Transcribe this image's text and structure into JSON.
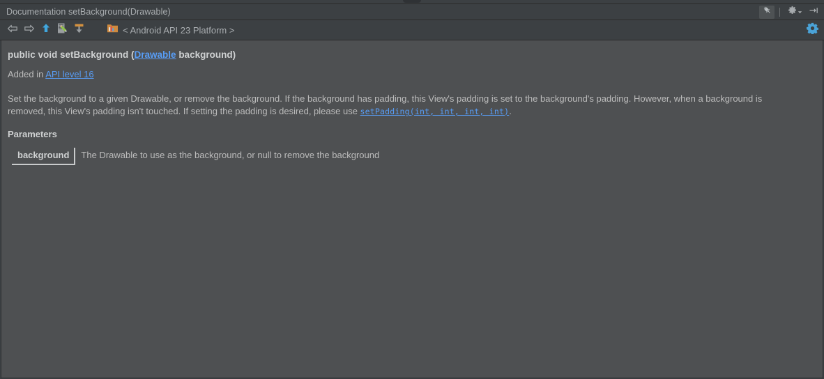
{
  "titlebar": {
    "title": "Documentation setBackground(Drawable)",
    "actions": [
      {
        "name": "pin-icon",
        "label": "Pin",
        "selected": true
      },
      {
        "name": "gear-icon",
        "label": "Settings",
        "selected": false
      },
      {
        "name": "hide-icon",
        "label": "Hide",
        "selected": false
      }
    ]
  },
  "toolbar": {
    "buttons": [
      {
        "name": "back-icon",
        "label": "Back"
      },
      {
        "name": "forward-icon",
        "label": "Forward"
      },
      {
        "name": "up-icon",
        "label": "Up"
      },
      {
        "name": "edit-source-icon",
        "label": "Edit Source"
      },
      {
        "name": "autoscroll-icon",
        "label": "Auto Scroll to Source"
      }
    ],
    "breadcrumb": {
      "icon": "android-sdk-icon",
      "label": "< Android API 23 Platform >"
    },
    "settings_gear": {
      "name": "settings-gear-icon",
      "label": "Settings"
    }
  },
  "doc": {
    "signature": {
      "prefix": "public void setBackground (",
      "link": "Drawable",
      "suffix": " background)"
    },
    "added": {
      "prefix": "Added in ",
      "link": "API level 16"
    },
    "description": {
      "part1": "Set the background to a given Drawable, or remove the background. If the background has padding, this View's padding is set to the background's padding. However, when a background is removed, this View's padding isn't touched. If setting the padding is desired, please use ",
      "link": "setPadding(int, int, int, int)",
      "part2": "."
    },
    "parameters_heading": "Parameters",
    "parameters": [
      {
        "name": "background",
        "description": "The Drawable to use as the background, or null to remove the background"
      }
    ]
  },
  "colors": {
    "panel_bg": "#3c4043",
    "content_bg": "#4e5052",
    "link": "#589df6",
    "text": "#bcbcbc",
    "accent_blue": "#3f9fd8"
  }
}
